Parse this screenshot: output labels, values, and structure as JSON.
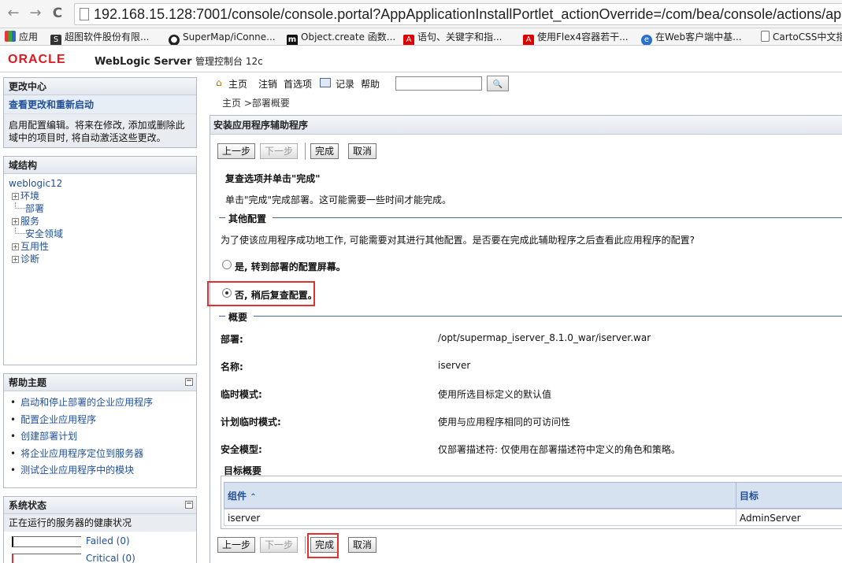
{
  "browser": {
    "back": "←",
    "forward": "→",
    "reload": "C",
    "url": "192.168.15.128:7001/console/console.portal?AppApplicationInstallPortlet_actionOverride=/com/bea/console/actions/app/in",
    "bookmarks": [
      {
        "label": "应用",
        "icon": "apps-grid-icon"
      },
      {
        "label": "超图软件股份有限...",
        "icon": "supermap-icon"
      },
      {
        "label": "SuperMap/iConne...",
        "icon": "github-icon"
      },
      {
        "label": "Object.create 函数...",
        "icon": "m-logo-icon"
      },
      {
        "label": "语句、关键字和指...",
        "icon": "adobe-icon"
      },
      {
        "label": "使用Flex4容器若干...",
        "icon": "adobe-icon"
      },
      {
        "label": "在Web客户端中基...",
        "icon": "globe-icon"
      },
      {
        "label": "CartoCSS中文指",
        "icon": "document-icon"
      }
    ]
  },
  "header": {
    "logo": "ORACLE",
    "product": "WebLogic Server",
    "product_sub": "管理控制台 12c"
  },
  "change_center": {
    "title": "更改中心",
    "link": "查看更改和重新启动",
    "description": "启用配置编辑。将来在修改, 添加或删除此域中的项目时, 将自动激活这些更改。"
  },
  "domain_structure": {
    "title": "域结构",
    "root": "weblogic12",
    "items": [
      {
        "label": "环境",
        "expandable": true
      },
      {
        "label": "部署",
        "expandable": false
      },
      {
        "label": "服务",
        "expandable": true
      },
      {
        "label": "安全领域",
        "expandable": false
      },
      {
        "label": "互用性",
        "expandable": true
      },
      {
        "label": "诊断",
        "expandable": true
      }
    ]
  },
  "help_topics": {
    "title": "帮助主题",
    "items": [
      "启动和停止部署的企业应用程序",
      "配置企业应用程序",
      "创建部署计划",
      "将企业应用程序定位到服务器",
      "测试企业应用程序中的模块"
    ]
  },
  "system_status": {
    "title": "系统状态",
    "subtitle": "正在运行的服务器的健康状况",
    "rows": [
      {
        "label": "Failed (0)",
        "color": "#000000"
      },
      {
        "label": "Critical (0)",
        "color": "#e0302f"
      }
    ]
  },
  "toolbar": {
    "home": "主页",
    "logout": "注销",
    "preferences": "首选项",
    "record": "记录",
    "help": "帮助",
    "search_value": "",
    "search_button": "🔍"
  },
  "breadcrumb": "主页 >部署概要",
  "wizard": {
    "title": "安装应用程序辅助程序",
    "back": "上一步",
    "next": "下一步",
    "finish": "完成",
    "cancel": "取消",
    "review_heading": "复查选项并单击\"完成\"",
    "review_text": "单击\"完成\"完成部署。这可能需要一些时间才能完成。",
    "other_config_heading": "其他配置",
    "other_config_question": "为了使该应用程序成功地工作, 可能需要对其进行其他配置。是否要在完成此辅助程序之后查看此应用程序的配置?",
    "option_yes": "是, 转到部署的配置屏幕。",
    "option_no": "否, 稍后复查配置。",
    "selected_option": "no",
    "summary_heading": "概要",
    "summary": [
      {
        "label": "部署:",
        "value": "/opt/supermap_iserver_8.1.0_war/iserver.war"
      },
      {
        "label": "名称:",
        "value": "iserver"
      },
      {
        "label": "临时模式:",
        "value": "使用所选目标定义的默认值"
      },
      {
        "label": "计划临时模式:",
        "value": "使用与应用程序相同的可访问性"
      },
      {
        "label": "安全模型:",
        "value": "仅部署描述符: 仅使用在部署描述符中定义的角色和策略。"
      }
    ],
    "target_summary_heading": "目标概要",
    "target_table": {
      "col_component": "组件",
      "col_target": "目标",
      "rows": [
        {
          "component": "iserver",
          "target": "AdminServer"
        }
      ]
    }
  }
}
